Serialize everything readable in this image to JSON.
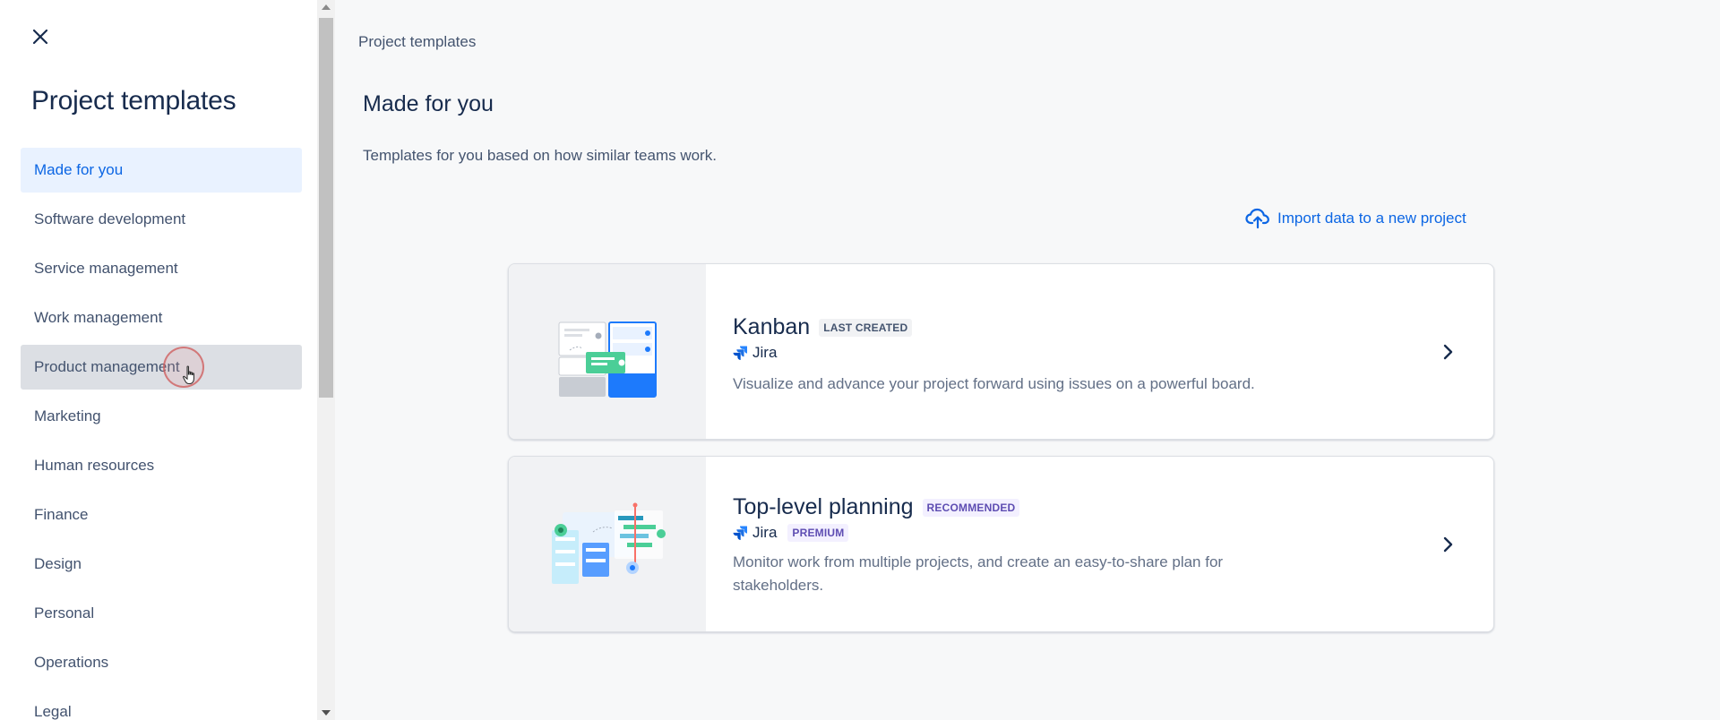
{
  "sidebar": {
    "title": "Project templates",
    "items": [
      {
        "label": "Made for you"
      },
      {
        "label": "Software development"
      },
      {
        "label": "Service management"
      },
      {
        "label": "Work management"
      },
      {
        "label": "Product management"
      },
      {
        "label": "Marketing"
      },
      {
        "label": "Human resources"
      },
      {
        "label": "Finance"
      },
      {
        "label": "Design"
      },
      {
        "label": "Personal"
      },
      {
        "label": "Operations"
      },
      {
        "label": "Legal"
      }
    ]
  },
  "main": {
    "breadcrumb": "Project templates",
    "title": "Made for you",
    "description": "Templates for you based on how similar teams work.",
    "import_label": "Import data to a new project",
    "cards": [
      {
        "title": "Kanban",
        "badge": "LAST CREATED",
        "product": "Jira",
        "description": "Visualize and advance your project forward using issues on a powerful board."
      },
      {
        "title": "Top-level planning",
        "badge": "RECOMMENDED",
        "product": "Jira",
        "plan": "PREMIUM",
        "description_line1": "Monitor work from multiple projects, and create an easy-to-share plan for",
        "description_line2": "stakeholders."
      }
    ]
  },
  "colors": {
    "accent": "#0C66E4",
    "active_bg": "#E9F2FF",
    "hover_bg": "#DCDFE4",
    "text": "#172B4D"
  }
}
